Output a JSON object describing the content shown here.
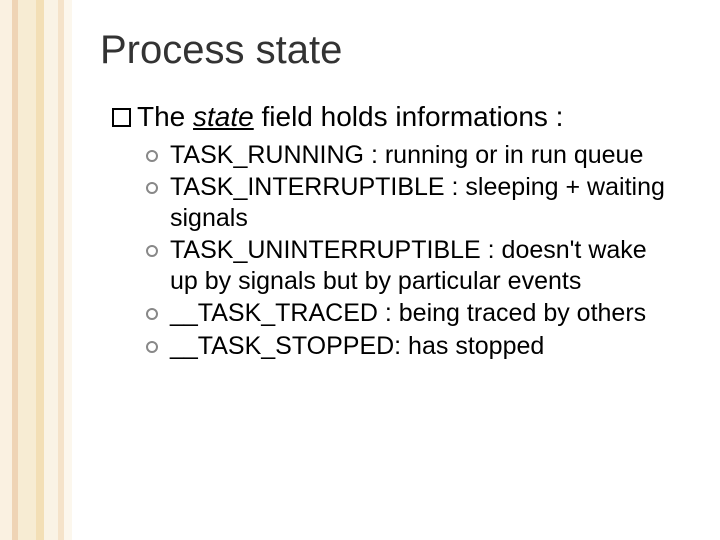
{
  "title": "Process state",
  "intro_pre": "The ",
  "intro_state_word": "state",
  "intro_post": " field holds informations :",
  "items": [
    "TASK_RUNNING : running or in run queue",
    "TASK_INTERRUPTIBLE : sleeping + waiting signals",
    "TASK_UNINTERRUPTIBLE : doesn't wake up by signals but by particular events",
    "__TASK_TRACED : being traced by others",
    "__TASK_STOPPED: has stopped"
  ]
}
